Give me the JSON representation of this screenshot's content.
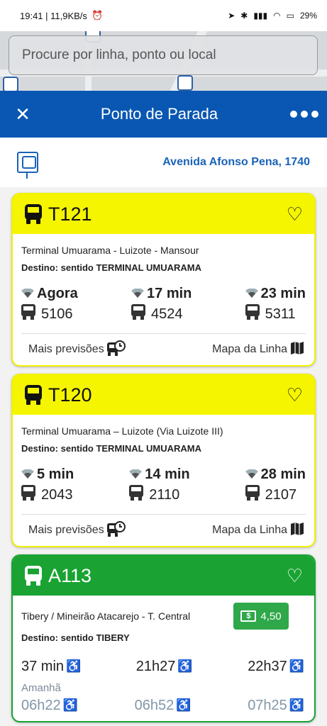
{
  "status": {
    "time_speed": "19:41 | 11,9KB/s",
    "battery": "29%"
  },
  "search": {
    "placeholder": "Procure por linha, ponto ou local"
  },
  "header": {
    "title": "Ponto de Parada"
  },
  "stop": {
    "address": "Avenida Afonso Pena, 1740"
  },
  "cards": [
    {
      "line": "T121",
      "route": "Terminal Umuarama  -  Luizote - Mansour",
      "destination": "Destino: sentido TERMINAL UMUARAMA",
      "predictions": [
        {
          "time": "Agora",
          "vehicle": "5106"
        },
        {
          "time": "17 min",
          "vehicle": "4524"
        },
        {
          "time": "23 min",
          "vehicle": "5311"
        }
      ],
      "more_label": "Mais previsões",
      "map_label": "Mapa da Linha"
    },
    {
      "line": "T120",
      "route": "Terminal Umuarama – Luizote (Via Luizote III)",
      "destination": "Destino: sentido TERMINAL UMUARAMA",
      "predictions": [
        {
          "time": "5 min",
          "vehicle": "2043"
        },
        {
          "time": "14 min",
          "vehicle": "2110"
        },
        {
          "time": "28 min",
          "vehicle": "2107"
        }
      ],
      "more_label": "Mais previsões",
      "map_label": "Mapa da Linha"
    },
    {
      "line": "A113",
      "route": "Tibery / Mineirão Atacarejo - T. Central",
      "fare": "4,50",
      "destination": "Destino: sentido TIBERY",
      "times_today": [
        "37 min",
        "21h27",
        "22h37"
      ],
      "tomorrow_label": "Amanhã",
      "times_tomorrow": [
        "06h22",
        "06h52",
        "07h25"
      ]
    }
  ],
  "colors": {
    "header_blue": "#0a57b3",
    "yellow_line": "#f5f500",
    "green_line": "#1aa332",
    "link_blue": "#1a63b8"
  },
  "icons": [
    "close-icon",
    "more-dots-icon",
    "bus-stop-icon",
    "bus-icon",
    "heart-icon",
    "signal-icon",
    "bus-schedule-icon",
    "map-icon",
    "wheelchair-icon",
    "money-icon"
  ]
}
